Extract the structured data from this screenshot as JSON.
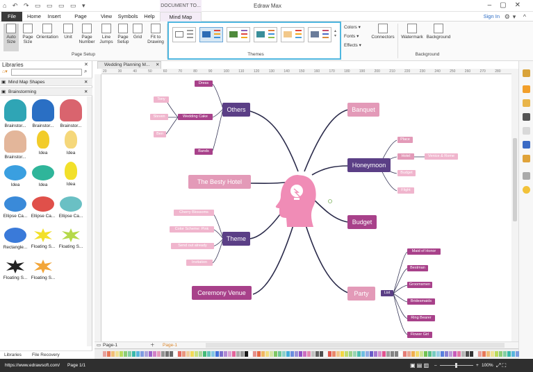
{
  "app": {
    "title": "Edraw Max",
    "doc_tools_tab": "DOCUMENT TO..."
  },
  "menu": {
    "items": [
      "File",
      "Home",
      "Insert",
      "Page Layout",
      "View",
      "Symbols",
      "Help",
      "Mind Map"
    ],
    "sign_in": "Sign In"
  },
  "ribbon": {
    "page_setup": {
      "buttons": [
        "Auto Size",
        "Page Size",
        "Orientation",
        "Unit",
        "Page Number",
        "Line Jumps",
        "Page Setup",
        "Grid",
        "Fit to Drawing"
      ],
      "label": "Page Setup"
    },
    "themes": {
      "label": "Themes"
    },
    "options": {
      "colors": "Colors",
      "fonts": "Fonts",
      "effects": "Effects",
      "connectors": "Connectors"
    },
    "background": {
      "watermark": "Watermark",
      "background": "Background",
      "label": "Background"
    }
  },
  "libraries": {
    "title": "Libraries",
    "categories": [
      "Mind Map Shapes",
      "Brainstorming"
    ],
    "shapes": [
      {
        "label": "Brainstor...",
        "icon": "head-teal-icon"
      },
      {
        "label": "Brainstor...",
        "icon": "head-blue-icon"
      },
      {
        "label": "Brainstor...",
        "icon": "brain-pink-icon"
      },
      {
        "label": "Brainstor...",
        "icon": "brain-beige-icon"
      },
      {
        "label": "Idea",
        "icon": "bulb-yellow-icon"
      },
      {
        "label": "Idea",
        "icon": "bulb-glow-icon"
      },
      {
        "label": "Idea",
        "icon": "cloud-blue-icon"
      },
      {
        "label": "Idea",
        "icon": "cloud-teal-icon"
      },
      {
        "label": "Idea",
        "icon": "balloon-yellow-icon"
      },
      {
        "label": "Ellipse Ca...",
        "icon": "callout-blue-icon"
      },
      {
        "label": "Ellipse Ca...",
        "icon": "callout-red-icon"
      },
      {
        "label": "Ellipse Ca...",
        "icon": "callout-teal-icon"
      },
      {
        "label": "Rectangle...",
        "icon": "rect-callout-icon"
      },
      {
        "label": "Floating S...",
        "icon": "burst-yellow-icon"
      },
      {
        "label": "Floating S...",
        "icon": "burst-green-icon"
      },
      {
        "label": "Floating S...",
        "icon": "burst-black-icon"
      },
      {
        "label": "Floating S...",
        "icon": "burst-orange-icon"
      }
    ],
    "bottom_tabs": [
      "Libraries",
      "File Recovery"
    ]
  },
  "document": {
    "tab": "Wedding Planning M...",
    "page_tabs": [
      "Page-1",
      "Page-1"
    ]
  },
  "ruler_ticks": [
    "20",
    "30",
    "40",
    "50",
    "60",
    "70",
    "80",
    "90",
    "100",
    "110",
    "120",
    "130",
    "140",
    "150",
    "160",
    "170",
    "180",
    "190",
    "200",
    "210",
    "220",
    "230",
    "240",
    "250",
    "260",
    "270",
    "280"
  ],
  "mindmap": {
    "branches": {
      "others": "Others",
      "theme": "Theme",
      "besty_hotel": "The Besty Hotel",
      "ceremony_venue": "Ceremony Venue",
      "banquet": "Banquet",
      "honeymoon": "Honeymoon",
      "budget": "Budget",
      "party": "Party"
    },
    "others_children": {
      "dress": "Dress",
      "wedding_cake": "Wedding Cake",
      "bands": "Bands",
      "tony": "Tony",
      "steven": "Steven",
      "ben": "Ben"
    },
    "theme_children": {
      "cherry": "Cherry Blossoms",
      "color": "Color Scheme: Pink",
      "send": "Send out already",
      "invitation": "Invitation"
    },
    "honeymoon_children": {
      "place": "Place",
      "hotel": "Hotel",
      "venice": "Venice & Rome",
      "budget": "Budget",
      "flight": "Flight"
    },
    "party_children": {
      "list": "List",
      "maid": "Maid of Honor",
      "bestman": "Bestman",
      "groomsmen": "Groomsmen",
      "bridesmaids": "Bridesmaids",
      "ring": "Ring Bearer",
      "flower": "Flower Girl"
    }
  },
  "status": {
    "url": "https://www.edrawsoft.com/",
    "page": "Page 1/1",
    "zoom": "100%"
  },
  "colors": {
    "accent_blue": "#4fb7e0",
    "branch_purple": "#5b3f86",
    "branch_pink": "#e39ab8",
    "branch_magenta": "#a8418a",
    "head_pink": "#f08cb6"
  }
}
